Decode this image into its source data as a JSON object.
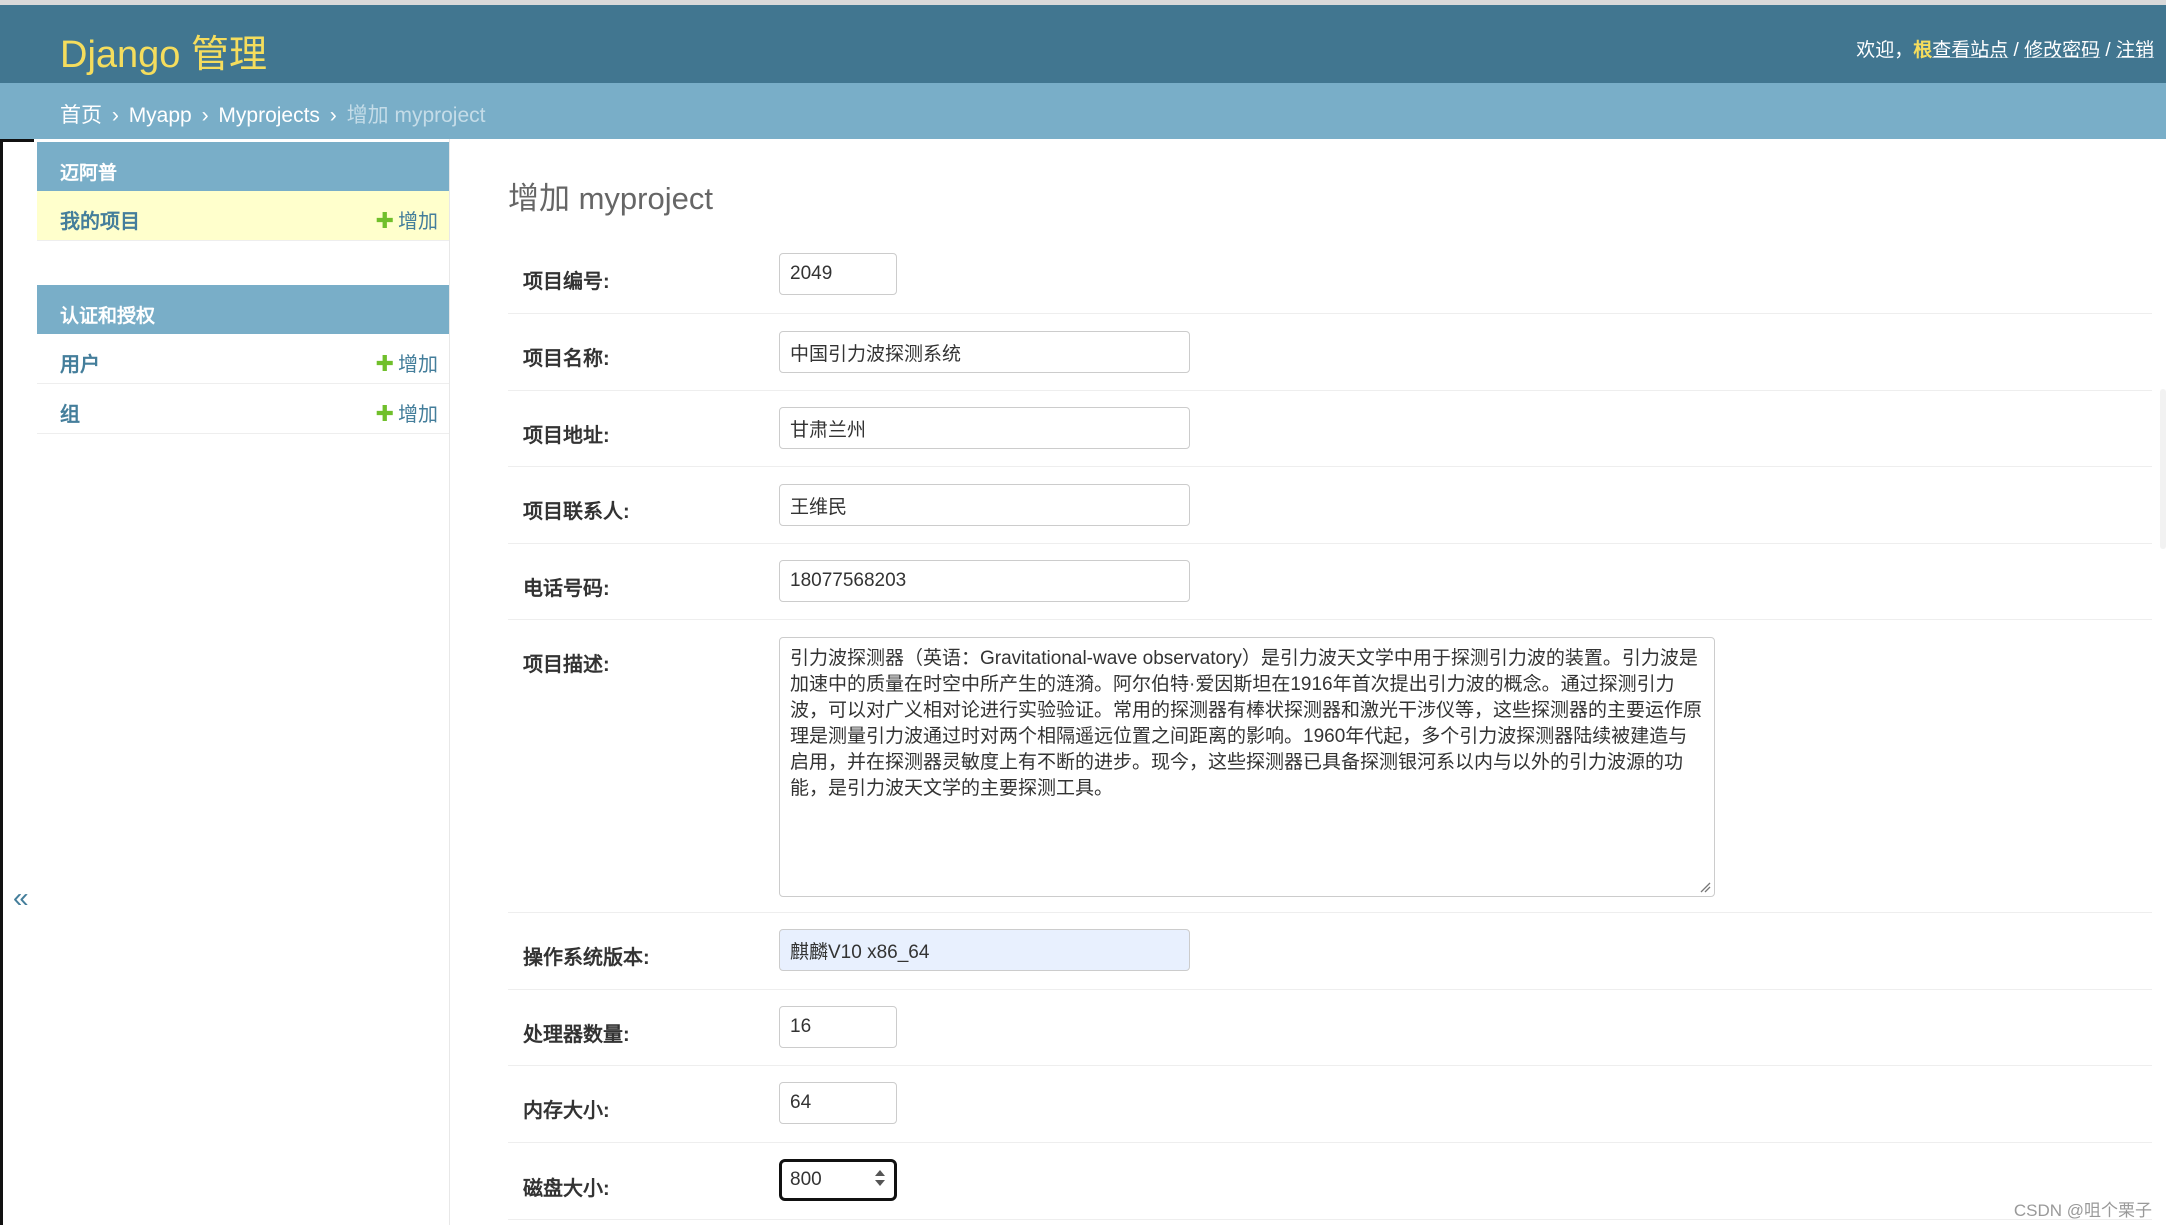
{
  "header": {
    "brand": "Django 管理",
    "welcome": "欢迎，",
    "username": "根",
    "view_site": "查看站点",
    "sep1": " / ",
    "change_password": "修改密码",
    "sep2": " / ",
    "logout": "注销"
  },
  "breadcrumbs": {
    "home": "首页",
    "app": "Myapp",
    "model": "Myprojects",
    "current": "增加 myproject",
    "separator": "›"
  },
  "sidebar": {
    "toggle_glyph": "«",
    "modules": [
      {
        "caption": "迈阿普",
        "rows": [
          {
            "name": "我的项目",
            "add": "增加"
          }
        ]
      },
      {
        "caption": "认证和授权",
        "rows": [
          {
            "name": "用户",
            "add": "增加"
          },
          {
            "name": "组",
            "add": "增加"
          }
        ]
      }
    ]
  },
  "form": {
    "title": "增加 myproject",
    "fields": {
      "project_no": {
        "label": "项目编号:",
        "value": "2049"
      },
      "project_name": {
        "label": "项目名称:",
        "value": "中国引力波探测系统"
      },
      "project_address": {
        "label": "项目地址:",
        "value": "甘肃兰州"
      },
      "project_contact": {
        "label": "项目联系人:",
        "value": "王维民"
      },
      "phone": {
        "label": "电话号码:",
        "value": "18077568203"
      },
      "description": {
        "label": "项目描述:",
        "value": "引力波探测器（英语：Gravitational-wave observatory）是引力波天文学中用于探测引力波的装置。引力波是加速中的质量在时空中所产生的涟漪。阿尔伯特·爱因斯坦在1916年首次提出引力波的概念。通过探测引力波，可以对广义相对论进行实验验证。常用的探测器有棒状探测器和激光干涉仪等，这些探测器的主要运作原理是测量引力波通过时对两个相隔遥远位置之间距离的影响。1960年代起，多个引力波探测器陆续被建造与启用，并在探测器灵敏度上有不断的进步。现今，这些探测器已具备探测银河系以内与以外的引力波源的功能，是引力波天文学的主要探测工具。"
      },
      "os_version": {
        "label": "操作系统版本:",
        "value": "麒麟V10 x86_64"
      },
      "cpu_count": {
        "label": "处理器数量:",
        "value": "16"
      },
      "memory_size": {
        "label": "内存大小:",
        "value": "64"
      },
      "disk_size": {
        "label": "磁盘大小:",
        "value": "800"
      }
    }
  },
  "watermark": "CSDN @咀个栗子",
  "colors": {
    "header_bg": "#417690",
    "breadcrumb_bg": "#79aec8",
    "brand_yellow": "#f5dd5d",
    "link_blue": "#447e9b",
    "add_green": "#70bf2b",
    "active_row_bg": "#ffffcc"
  }
}
